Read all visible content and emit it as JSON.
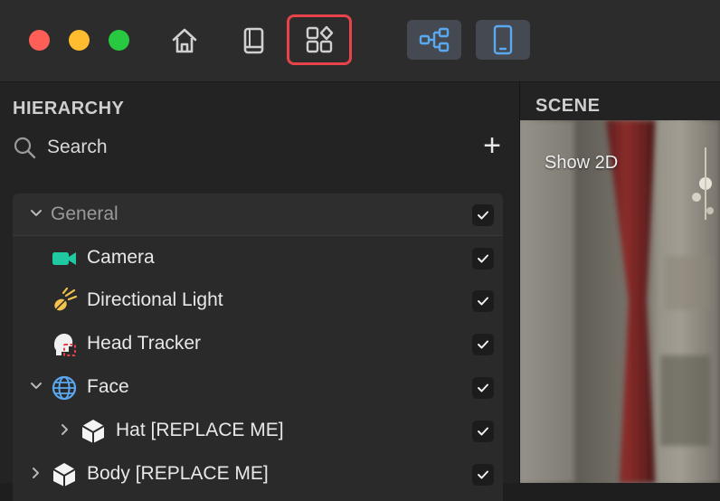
{
  "toolbar": {
    "buttons": [
      "home-icon",
      "book-icon",
      "widgets-grid-icon",
      "graph-icon",
      "phone-preview-icon"
    ],
    "highlight_color": "#e8424a"
  },
  "hierarchy": {
    "title": "HIERARCHY",
    "search_placeholder": "Search",
    "add_symbol": "+",
    "rows": [
      {
        "label": "General",
        "kind": "group",
        "expanded": true,
        "checked": true
      },
      {
        "label": "Camera",
        "icon": "camera-icon",
        "checked": true
      },
      {
        "label": "Directional Light",
        "icon": "directional-light-icon",
        "checked": true
      },
      {
        "label": "Head Tracker",
        "icon": "head-tracker-icon",
        "checked": true
      },
      {
        "label": "Face",
        "icon": "face-globe-icon",
        "expanded": true,
        "checked": true
      },
      {
        "label": "Hat [REPLACE ME]",
        "icon": "cube-icon",
        "expanded": false,
        "checked": true
      },
      {
        "label": "Body [REPLACE ME]",
        "icon": "cube-icon",
        "expanded": false,
        "checked": true
      }
    ]
  },
  "scene": {
    "title": "SCENE",
    "overlay_label": "Show 2D"
  }
}
